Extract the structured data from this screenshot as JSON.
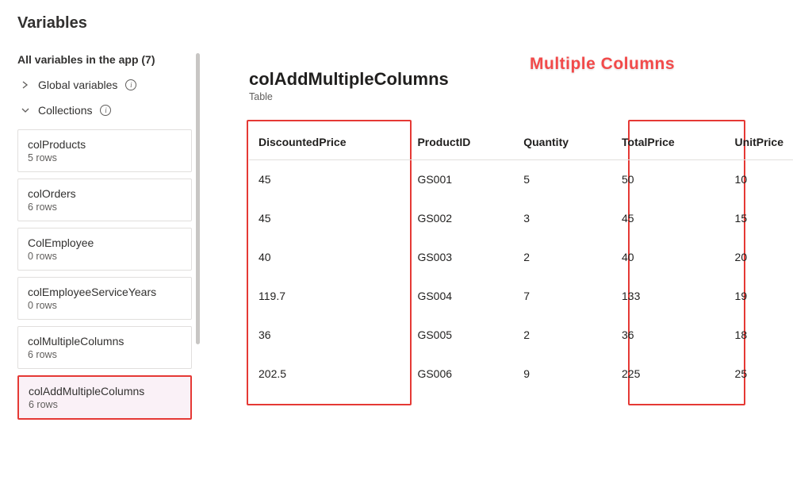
{
  "panel_title": "Variables",
  "sidebar": {
    "heading": "All variables in the app (7)",
    "global_label": "Global variables",
    "collections_label": "Collections",
    "items": [
      {
        "name": "colProducts",
        "meta": "5 rows"
      },
      {
        "name": "colOrders",
        "meta": "6 rows"
      },
      {
        "name": "ColEmployee",
        "meta": "0 rows"
      },
      {
        "name": "colEmployeeServiceYears",
        "meta": "0 rows"
      },
      {
        "name": "colMultipleColumns",
        "meta": "6 rows"
      },
      {
        "name": "colAddMultipleColumns",
        "meta": "6 rows"
      }
    ]
  },
  "detail": {
    "title": "colAddMultipleColumns",
    "subtitle": "Table",
    "annotation": "Multiple Columns"
  },
  "table": {
    "headers": [
      "DiscountedPrice",
      "ProductID",
      "Quantity",
      "TotalPrice",
      "UnitPrice"
    ],
    "rows": [
      [
        "45",
        "GS001",
        "5",
        "50",
        "10"
      ],
      [
        "45",
        "GS002",
        "3",
        "45",
        "15"
      ],
      [
        "40",
        "GS003",
        "2",
        "40",
        "20"
      ],
      [
        "119.7",
        "GS004",
        "7",
        "133",
        "19"
      ],
      [
        "36",
        "GS005",
        "2",
        "36",
        "18"
      ],
      [
        "202.5",
        "GS006",
        "9",
        "225",
        "25"
      ]
    ]
  }
}
